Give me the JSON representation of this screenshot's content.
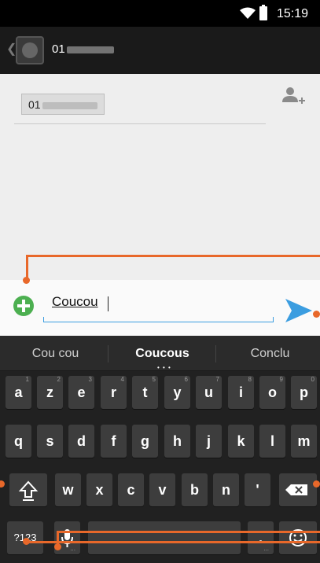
{
  "status_bar": {
    "time": "15:19"
  },
  "action_bar": {
    "contact_prefix": "01"
  },
  "recipient": {
    "chip_prefix": "01"
  },
  "compose": {
    "message_text": "Coucou"
  },
  "keyboard": {
    "suggestions": [
      "Cou cou",
      "Coucous",
      "Conclu"
    ],
    "suggestion_dots": "• • •",
    "row1": [
      {
        "k": "a",
        "h": "1"
      },
      {
        "k": "z",
        "h": "2"
      },
      {
        "k": "e",
        "h": "3"
      },
      {
        "k": "r",
        "h": "4"
      },
      {
        "k": "t",
        "h": "5"
      },
      {
        "k": "y",
        "h": "6"
      },
      {
        "k": "u",
        "h": "7"
      },
      {
        "k": "i",
        "h": "8"
      },
      {
        "k": "o",
        "h": "9"
      },
      {
        "k": "p",
        "h": "0"
      }
    ],
    "row2": [
      "q",
      "s",
      "d",
      "f",
      "g",
      "h",
      "j",
      "k",
      "l",
      "m"
    ],
    "row3": [
      "w",
      "x",
      "c",
      "v",
      "b",
      "n",
      "'"
    ],
    "symbols_label": "?123",
    "period_label": ".",
    "ellipsis_label": "..."
  },
  "colors": {
    "accent": "#3b9de0",
    "attach": "#4caf50",
    "callout": "#e8682a"
  }
}
